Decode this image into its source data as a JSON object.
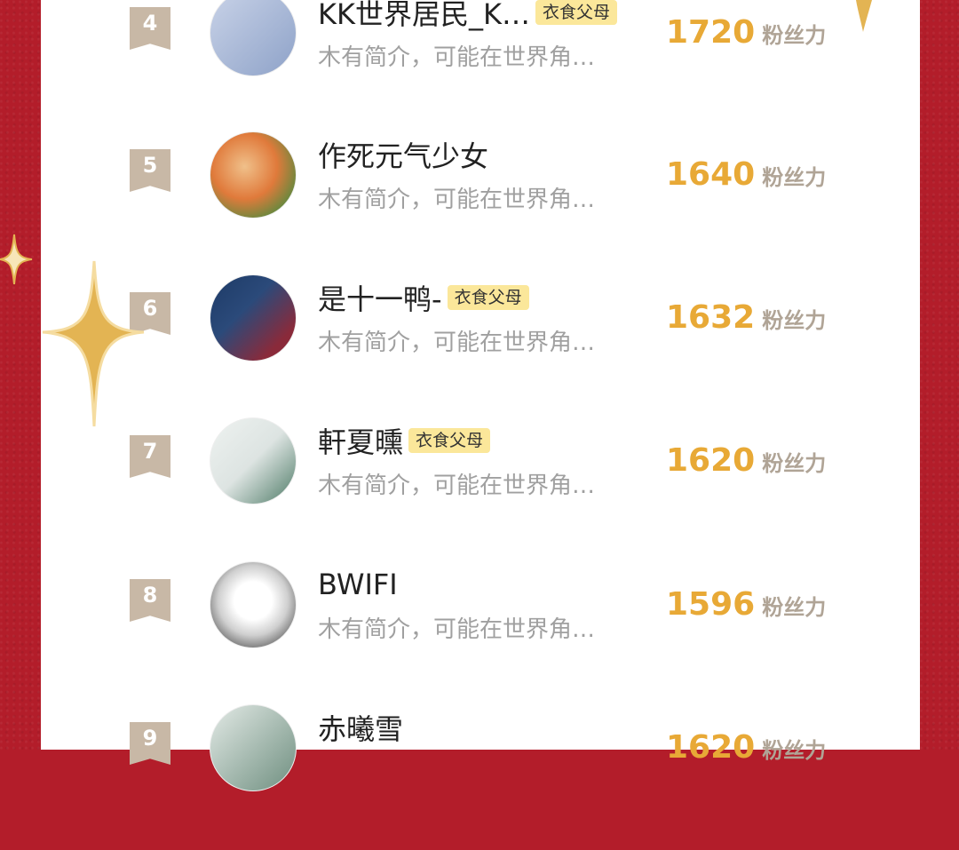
{
  "list": [
    {
      "rank": "4",
      "name": "KK世界居民_K…",
      "tag": "衣食父母",
      "intro": "木有简介，可能在世界角…",
      "fans": "1720",
      "unit": "粉丝力",
      "avatar_colors": [
        "#c9d3e8",
        "#8ea2c8"
      ]
    },
    {
      "rank": "5",
      "name": "作死元气少女",
      "tag": "",
      "intro": "木有简介，可能在世界角…",
      "fans": "1640",
      "unit": "粉丝力",
      "avatar_colors": [
        "#e07a3b",
        "#5a8a3e"
      ]
    },
    {
      "rank": "6",
      "name": "是十一鸭-",
      "tag": "衣食父母",
      "intro": "木有简介，可能在世界角…",
      "fans": "1632",
      "unit": "粉丝力",
      "avatar_colors": [
        "#2b4a7a",
        "#8a2a3a"
      ]
    },
    {
      "rank": "7",
      "name": "軒夏曛",
      "tag": "衣食父母",
      "intro": "木有简介，可能在世界角…",
      "fans": "1620",
      "unit": "粉丝力",
      "avatar_colors": [
        "#dde4e2",
        "#4d7a66"
      ]
    },
    {
      "rank": "8",
      "name": "BWIFI",
      "tag": "",
      "intro": "木有简介，可能在世界角…",
      "fans": "1596",
      "unit": "粉丝力",
      "avatar_colors": [
        "#f5f5f5",
        "#444444"
      ]
    },
    {
      "rank": "9",
      "name": "赤曦雪",
      "tag": "",
      "intro": "",
      "fans": "1620",
      "unit": "粉丝力",
      "avatar_colors": [
        "#e3eae6",
        "#6f8f80"
      ]
    }
  ],
  "colors": {
    "background": "#b31d2a",
    "accent": "#e8a936",
    "tag_bg": "#fbe79a",
    "rank_badge": "#c8b8a6"
  },
  "icons": [
    "gold-sparkle-icon"
  ]
}
